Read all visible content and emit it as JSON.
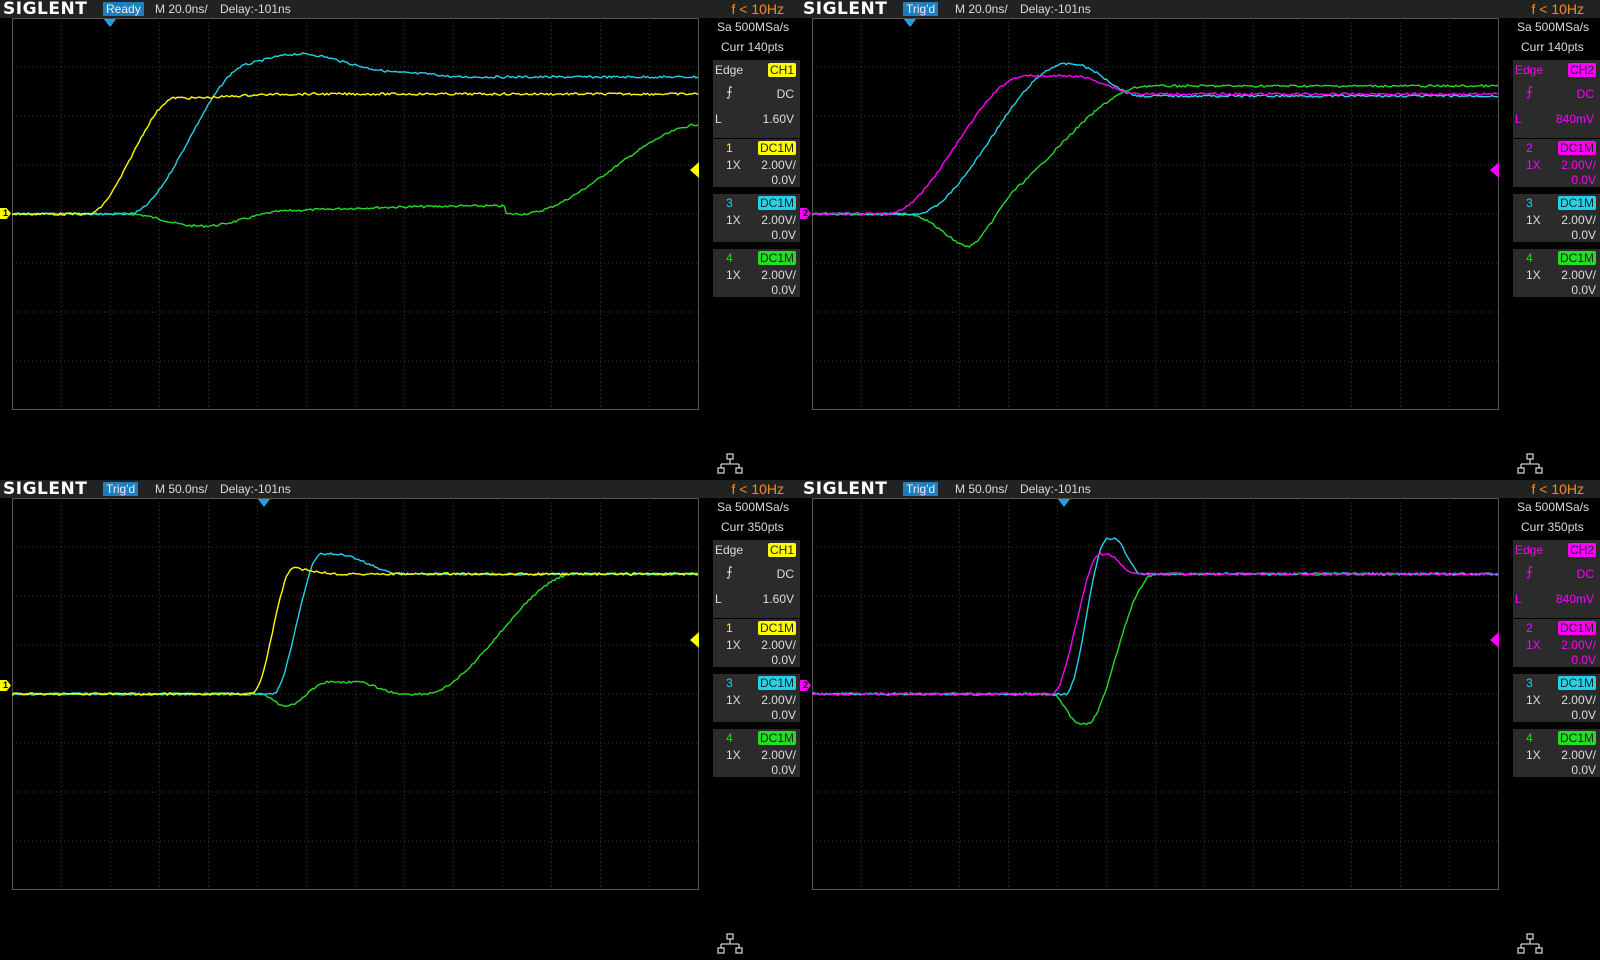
{
  "panels": [
    {
      "brand": "SIGLENT",
      "status": "Ready",
      "timebase": "M 20.0ns/",
      "delay": "Delay:-101ns",
      "freq": "f < 10Hz",
      "sample_rate": "Sa 500MSa/s",
      "curr_pts": "Curr 140pts",
      "trigger": {
        "type": "Edge",
        "source": "CH1",
        "coupling": "DC",
        "level": "1.60V"
      },
      "channels": [
        {
          "num": "1",
          "coupling": "DC1M",
          "probe": "1X",
          "scale": "2.00V/",
          "offset": "0.0V"
        },
        {
          "num": "3",
          "coupling": "DC1M",
          "probe": "1X",
          "scale": "2.00V/",
          "offset": "0.0V"
        },
        {
          "num": "4",
          "coupling": "DC1M",
          "probe": "1X",
          "scale": "2.00V/",
          "offset": "0.0V"
        }
      ],
      "ground_marker": "1"
    },
    {
      "brand": "SIGLENT",
      "status": "Trig'd",
      "timebase": "M 20.0ns/",
      "delay": "Delay:-101ns",
      "freq": "f < 10Hz",
      "sample_rate": "Sa 500MSa/s",
      "curr_pts": "Curr 140pts",
      "trigger": {
        "type": "Edge",
        "source": "CH2",
        "coupling": "DC",
        "level": "840mV"
      },
      "channels": [
        {
          "num": "2",
          "coupling": "DC1M",
          "probe": "1X",
          "scale": "2.00V/",
          "offset": "0.0V"
        },
        {
          "num": "3",
          "coupling": "DC1M",
          "probe": "1X",
          "scale": "2.00V/",
          "offset": "0.0V"
        },
        {
          "num": "4",
          "coupling": "DC1M",
          "probe": "1X",
          "scale": "2.00V/",
          "offset": "0.0V"
        }
      ],
      "ground_marker": "2"
    },
    {
      "brand": "SIGLENT",
      "status": "Trig'd",
      "timebase": "M 50.0ns/",
      "delay": "Delay:-101ns",
      "freq": "f < 10Hz",
      "sample_rate": "Sa 500MSa/s",
      "curr_pts": "Curr 350pts",
      "trigger": {
        "type": "Edge",
        "source": "CH1",
        "coupling": "DC",
        "level": "1.60V"
      },
      "channels": [
        {
          "num": "1",
          "coupling": "DC1M",
          "probe": "1X",
          "scale": "2.00V/",
          "offset": "0.0V"
        },
        {
          "num": "3",
          "coupling": "DC1M",
          "probe": "1X",
          "scale": "2.00V/",
          "offset": "0.0V"
        },
        {
          "num": "4",
          "coupling": "DC1M",
          "probe": "1X",
          "scale": "2.00V/",
          "offset": "0.0V"
        }
      ],
      "ground_marker": "1"
    },
    {
      "brand": "SIGLENT",
      "status": "Trig'd",
      "timebase": "M 50.0ns/",
      "delay": "Delay:-101ns",
      "freq": "f < 10Hz",
      "sample_rate": "Sa 500MSa/s",
      "curr_pts": "Curr 350pts",
      "trigger": {
        "type": "Edge",
        "source": "CH2",
        "coupling": "DC",
        "level": "840mV"
      },
      "channels": [
        {
          "num": "2",
          "coupling": "DC1M",
          "probe": "1X",
          "scale": "2.00V/",
          "offset": "0.0V"
        },
        {
          "num": "3",
          "coupling": "DC1M",
          "probe": "1X",
          "scale": "2.00V/",
          "offset": "0.0V"
        },
        {
          "num": "4",
          "coupling": "DC1M",
          "probe": "1X",
          "scale": "2.00V/",
          "offset": "0.0V"
        }
      ],
      "ground_marker": "2"
    }
  ],
  "colors": {
    "ch1": "#ffff00",
    "ch2": "#ff00ff",
    "ch3": "#22d3e8",
    "ch4": "#22dd22",
    "status_bg": "#1d7fbd",
    "freq": "#ff8a1a",
    "trigger_marker": "#1aa3e8",
    "grid": "#3a3a3a"
  },
  "icons": {
    "network": "network-icon"
  }
}
